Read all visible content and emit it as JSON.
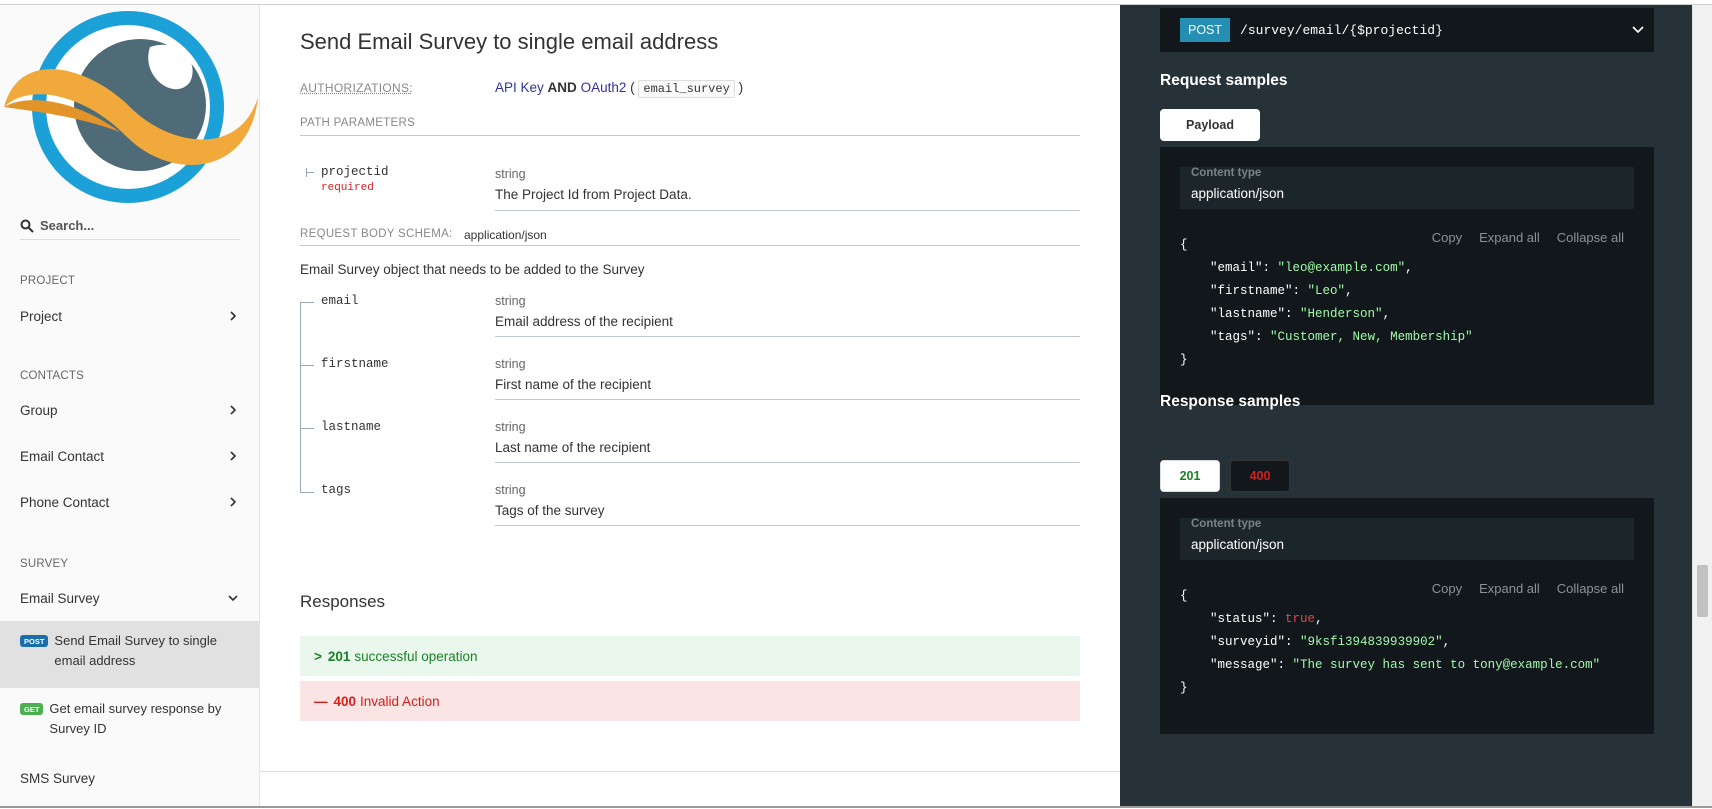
{
  "sidebar": {
    "search_placeholder": "Search...",
    "sections": [
      {
        "title": "PROJECT",
        "items": [
          {
            "label": "Project"
          }
        ]
      },
      {
        "title": "CONTACTS",
        "items": [
          {
            "label": "Group"
          },
          {
            "label": "Email Contact"
          },
          {
            "label": "Phone Contact"
          }
        ]
      },
      {
        "title": "SURVEY",
        "items": [
          {
            "label": "Email Survey"
          }
        ]
      }
    ],
    "operations": [
      {
        "badge": "POST",
        "label": "Send Email Survey to single email address"
      },
      {
        "badge": "GET",
        "label": "Get email survey response by Survey ID"
      }
    ],
    "next_item": "SMS Survey"
  },
  "main": {
    "title": "Send Email Survey to single email address",
    "authorizations_label": "AUTHORIZATIONS:",
    "auth": {
      "api_key": "API Key",
      "and": "AND",
      "oauth": "OAuth2",
      "scope": "email_survey"
    },
    "path_params_label": "PATH PARAMETERS",
    "path_params": [
      {
        "name": "projectid",
        "required": "required",
        "type": "string",
        "description": "The Project Id from Project Data."
      }
    ],
    "request_body_label": "REQUEST BODY SCHEMA:",
    "request_body_type": "application/json",
    "body_description": "Email Survey object that needs to be added to the Survey",
    "body_params": [
      {
        "name": "email",
        "type": "string",
        "description": "Email address of the recipient"
      },
      {
        "name": "firstname",
        "type": "string",
        "description": "First name of the recipient"
      },
      {
        "name": "lastname",
        "type": "string",
        "description": "Last name of the recipient"
      },
      {
        "name": "tags",
        "type": "string",
        "description": "Tags of the survey"
      }
    ],
    "responses_title": "Responses",
    "responses": [
      {
        "symbol": ">",
        "code": "201",
        "text": "successful operation"
      },
      {
        "symbol": "—",
        "code": "400",
        "text": "Invalid Action"
      }
    ]
  },
  "panel": {
    "method": "POST",
    "path": "/survey/email/{$projectid}",
    "request_samples_title": "Request samples",
    "payload_tab": "Payload",
    "content_type_label": "Content type",
    "content_type": "application/json",
    "actions": {
      "copy": "Copy",
      "expand": "Expand all",
      "collapse": "Collapse all"
    },
    "request_json": {
      "email": "\"leo@example.com\"",
      "firstname": "\"Leo\"",
      "lastname": "\"Henderson\"",
      "tags": "\"Customer, New, Membership\""
    },
    "response_samples_title": "Response samples",
    "response_tabs": [
      "201",
      "400"
    ],
    "response_json": {
      "status": "true",
      "surveyid": "\"9ksfi394839939902\"",
      "message": "\"The survey has sent to tony@example.com\""
    }
  }
}
